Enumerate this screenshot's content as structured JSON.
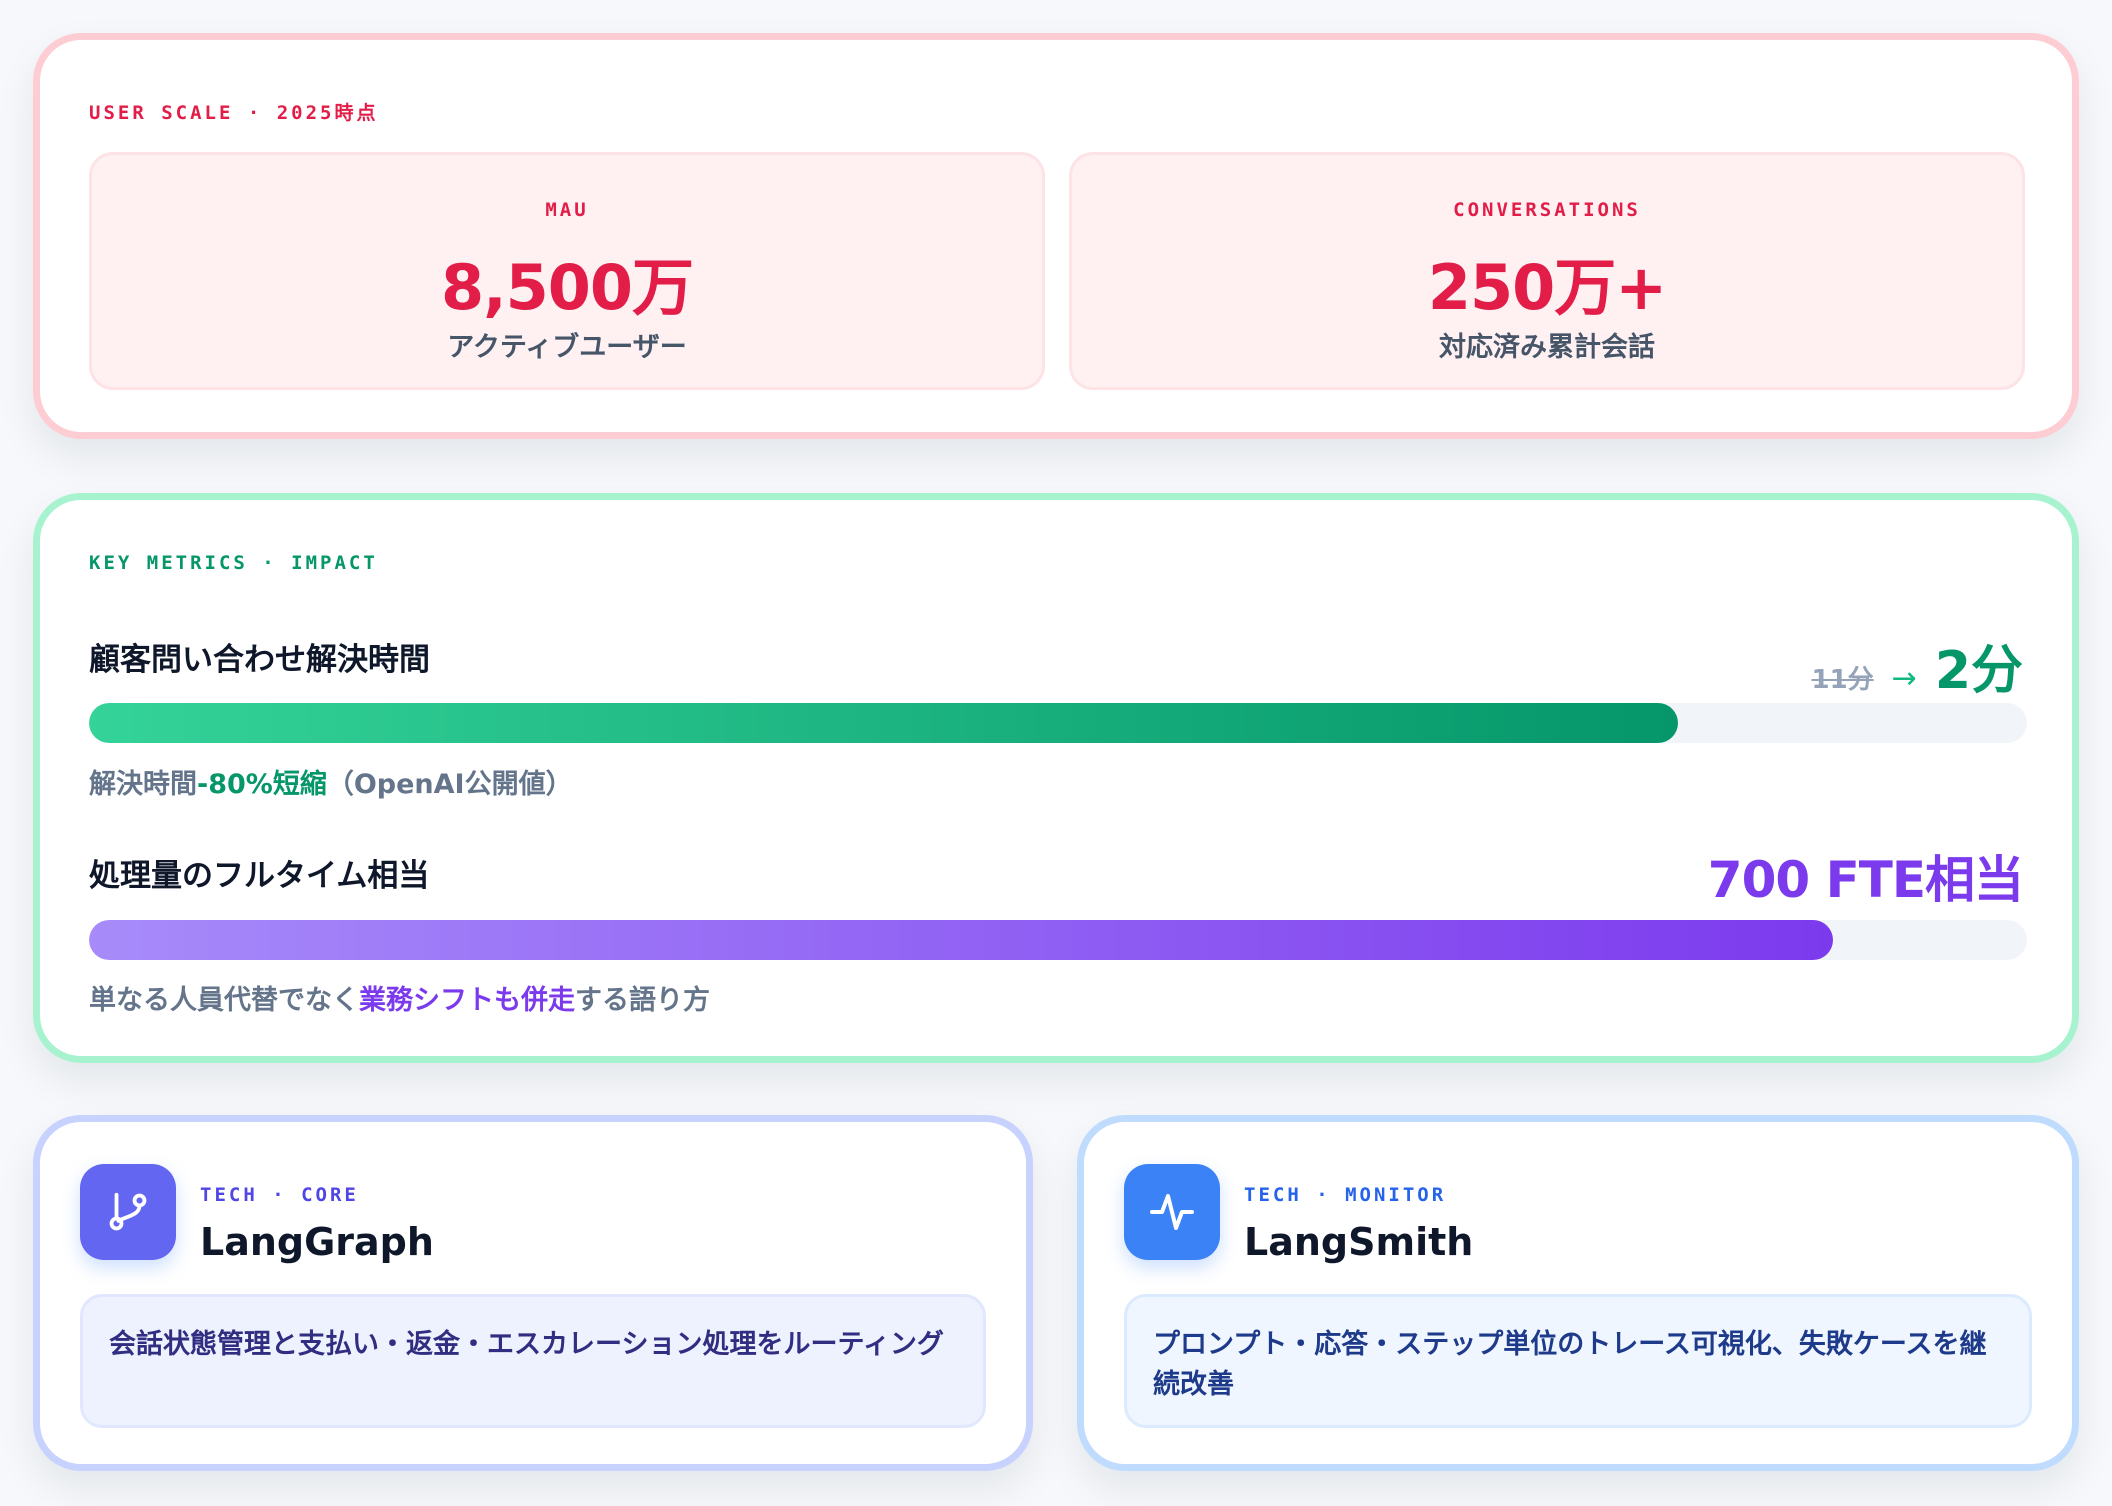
{
  "user_scale": {
    "section_label": "USER SCALE · 2025時点",
    "stats": [
      {
        "label": "MAU",
        "value": "8,500万",
        "sub": "アクティブユーザー"
      },
      {
        "label": "CONVERSATIONS",
        "value": "250万+",
        "sub": "対応済み累計会話"
      }
    ]
  },
  "metrics": {
    "section_label": "KEY METRICS · IMPACT",
    "resolution": {
      "title": "顧客問い合わせ解決時間",
      "old_value": "11分",
      "arrow": "→",
      "new_value": "2分",
      "progress": 0.82,
      "note_prefix": "解決時間",
      "note_highlight": "-80%短縮",
      "note_suffix": "（OpenAI公開値）"
    },
    "fte": {
      "title": "処理量のフルタイム相当",
      "value": "700 FTE相当",
      "progress": 0.9,
      "note_prefix": "単なる人員代替でなく",
      "note_highlight": "業務シフトも併走",
      "note_suffix": "する語り方"
    }
  },
  "tech": [
    {
      "tag": "TECH · CORE",
      "name": "LangGraph",
      "icon": "branch-icon",
      "description": "会話状態管理と支払い・返金・エスカレーション処理をルーティング"
    },
    {
      "tag": "TECH · MONITOR",
      "name": "LangSmith",
      "icon": "pulse-icon",
      "description": "プロンプト・応答・ステップ単位のトレース可視化、失敗ケースを継続改善"
    }
  ],
  "colors": {
    "user_scale_accent": "#e11d48",
    "metrics_accent": "#059669",
    "fte_accent": "#7c3aed",
    "langgraph_accent": "#6366f1",
    "langsmith_accent": "#3b82f6"
  }
}
